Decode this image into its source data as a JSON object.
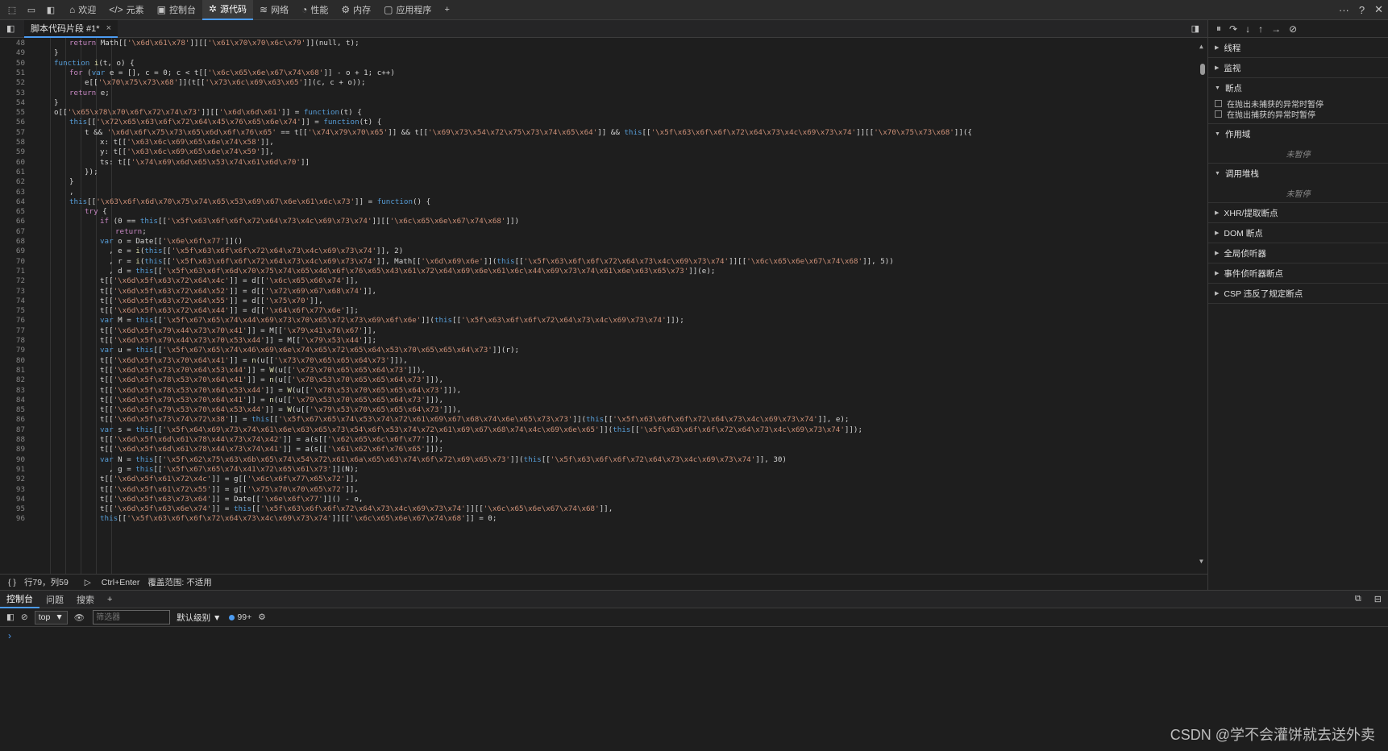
{
  "toolbar": {
    "tabs": [
      {
        "label": "欢迎",
        "icon": "home-icon"
      },
      {
        "label": "元素",
        "icon": "code-icon"
      },
      {
        "label": "控制台",
        "icon": "terminal-icon"
      },
      {
        "label": "源代码",
        "icon": "bug-icon"
      },
      {
        "label": "网络",
        "icon": "wifi-icon"
      },
      {
        "label": "性能",
        "icon": "gauge-icon"
      },
      {
        "label": "内存",
        "icon": "gear-icon"
      },
      {
        "label": "应用程序",
        "icon": "window-icon"
      }
    ],
    "add": "+",
    "more": "···",
    "help": "?",
    "close": "✕"
  },
  "file_tab": {
    "label": "脚本代码片段 #1*",
    "close": "×"
  },
  "editor": {
    "lines": [
      {
        "n": "48",
        "indent": 3,
        "html": "<span class=\"kw2\">return</span> Math[[<span class=\"str\">'\\x6d\\x61\\x78'</span>]][[<span class=\"str\">'\\x61\\x70\\x70\\x6c\\x79'</span>]](null, t);"
      },
      {
        "n": "49",
        "indent": 2,
        "html": "}"
      },
      {
        "n": "50",
        "indent": 2,
        "html": "<span class=\"kw\">function</span> <span class=\"fn\">i</span>(t, o) {"
      },
      {
        "n": "51",
        "indent": 3,
        "html": "<span class=\"kw2\">for</span> (<span class=\"kw\">var</span> e = [], c = 0; c &lt; t[[<span class=\"str\">'\\x6c\\x65\\x6e\\x67\\x74\\x68'</span>]] - o + 1; c++)"
      },
      {
        "n": "52",
        "indent": 4,
        "html": "e[[<span class=\"str\">'\\x70\\x75\\x73\\x68'</span>]](t[[<span class=\"str\">'\\x73\\x6c\\x69\\x63\\x65'</span>]](c, c + o));"
      },
      {
        "n": "53",
        "indent": 3,
        "html": "<span class=\"kw2\">return</span> e;"
      },
      {
        "n": "54",
        "indent": 2,
        "html": "}"
      },
      {
        "n": "55",
        "indent": 2,
        "html": "o[[<span class=\"str\">'\\x65\\x78\\x70\\x6f\\x72\\x74\\x73'</span>]][[<span class=\"str\">'\\x6d\\x6d\\x61'</span>]] = <span class=\"kw\">function</span>(t) {"
      },
      {
        "n": "56",
        "indent": 3,
        "html": "<span class=\"kw\">this</span>[[<span class=\"str\">'\\x72\\x65\\x63\\x6f\\x72\\x64\\x45\\x76\\x65\\x6e\\x74'</span>]] = <span class=\"kw\">function</span>(t) {"
      },
      {
        "n": "57",
        "indent": 4,
        "html": "t &amp;&amp; <span class=\"str\">'\\x6d\\x6f\\x75\\x73\\x65\\x6d\\x6f\\x76\\x65'</span> == t[[<span class=\"str\">'\\x74\\x79\\x70\\x65'</span>]] &amp;&amp; t[[<span class=\"str\">'\\x69\\x73\\x54\\x72\\x75\\x73\\x74\\x65\\x64'</span>]] &amp;&amp; <span class=\"kw\">this</span>[[<span class=\"str\">'\\x5f\\x63\\x6f\\x6f\\x72\\x64\\x73\\x4c\\x69\\x73\\x74'</span>]][[<span class=\"str\">'\\x70\\x75\\x73\\x68'</span>]]({"
      },
      {
        "n": "58",
        "indent": 5,
        "html": "x: t[[<span class=\"str\">'\\x63\\x6c\\x69\\x65\\x6e\\x74\\x58'</span>]],"
      },
      {
        "n": "59",
        "indent": 5,
        "html": "y: t[[<span class=\"str\">'\\x63\\x6c\\x69\\x65\\x6e\\x74\\x59'</span>]],"
      },
      {
        "n": "60",
        "indent": 5,
        "html": "ts: t[[<span class=\"str\">'\\x74\\x69\\x6d\\x65\\x53\\x74\\x61\\x6d\\x70'</span>]]"
      },
      {
        "n": "61",
        "indent": 4,
        "html": "});"
      },
      {
        "n": "62",
        "indent": 3,
        "html": "}"
      },
      {
        "n": "63",
        "indent": 3,
        "html": ","
      },
      {
        "n": "64",
        "indent": 3,
        "html": "<span class=\"kw\">this</span>[[<span class=\"str\">'\\x63\\x6f\\x6d\\x70\\x75\\x74\\x65\\x53\\x69\\x67\\x6e\\x61\\x6c\\x73'</span>]] = <span class=\"kw\">function</span>() {"
      },
      {
        "n": "65",
        "indent": 4,
        "html": "<span class=\"kw2\">try</span> {"
      },
      {
        "n": "66",
        "indent": 5,
        "html": "<span class=\"kw2\">if</span> (0 == <span class=\"kw\">this</span>[[<span class=\"str\">'\\x5f\\x63\\x6f\\x6f\\x72\\x64\\x73\\x4c\\x69\\x73\\x74'</span>]][[<span class=\"str\">'\\x6c\\x65\\x6e\\x67\\x74\\x68'</span>]])"
      },
      {
        "n": "67",
        "indent": 6,
        "html": "<span class=\"kw2\">return</span>;"
      },
      {
        "n": "68",
        "indent": 5,
        "html": "<span class=\"kw\">var</span> o = Date[[<span class=\"str\">'\\x6e\\x6f\\x77'</span>]]()"
      },
      {
        "n": "69",
        "indent": 5,
        "html": "  , e = <span class=\"fn\">i</span>(<span class=\"kw\">this</span>[[<span class=\"str\">'\\x5f\\x63\\x6f\\x6f\\x72\\x64\\x73\\x4c\\x69\\x73\\x74'</span>]], 2)"
      },
      {
        "n": "70",
        "indent": 5,
        "html": "  , r = <span class=\"fn\">i</span>(<span class=\"kw\">this</span>[[<span class=\"str\">'\\x5f\\x63\\x6f\\x6f\\x72\\x64\\x73\\x4c\\x69\\x73\\x74'</span>]], Math[[<span class=\"str\">'\\x6d\\x69\\x6e'</span>]](<span class=\"kw\">this</span>[[<span class=\"str\">'\\x5f\\x63\\x6f\\x6f\\x72\\x64\\x73\\x4c\\x69\\x73\\x74'</span>]][[<span class=\"str\">'\\x6c\\x65\\x6e\\x67\\x74\\x68'</span>]], 5))"
      },
      {
        "n": "71",
        "indent": 5,
        "html": "  , d = <span class=\"kw\">this</span>[[<span class=\"str\">'\\x5f\\x63\\x6f\\x6d\\x70\\x75\\x74\\x65\\x4d\\x6f\\x76\\x65\\x43\\x61\\x72\\x64\\x69\\x6e\\x61\\x6c\\x44\\x69\\x73\\x74\\x61\\x6e\\x63\\x65\\x73'</span>]](e);"
      },
      {
        "n": "72",
        "indent": 5,
        "html": "t[[<span class=\"str\">'\\x6d\\x5f\\x63\\x72\\x64\\x4c'</span>]] = d[[<span class=\"str\">'\\x6c\\x65\\x66\\x74'</span>]],"
      },
      {
        "n": "73",
        "indent": 5,
        "html": "t[[<span class=\"str\">'\\x6d\\x5f\\x63\\x72\\x64\\x52'</span>]] = d[[<span class=\"str\">'\\x72\\x69\\x67\\x68\\x74'</span>]],"
      },
      {
        "n": "74",
        "indent": 5,
        "html": "t[[<span class=\"str\">'\\x6d\\x5f\\x63\\x72\\x64\\x55'</span>]] = d[[<span class=\"str\">'\\x75\\x70'</span>]],"
      },
      {
        "n": "75",
        "indent": 5,
        "html": "t[[<span class=\"str\">'\\x6d\\x5f\\x63\\x72\\x64\\x44'</span>]] = d[[<span class=\"str\">'\\x64\\x6f\\x77\\x6e'</span>]];"
      },
      {
        "n": "76",
        "indent": 5,
        "html": "<span class=\"kw\">var</span> M = <span class=\"kw\">this</span>[[<span class=\"str\">'\\x5f\\x67\\x65\\x74\\x44\\x69\\x73\\x70\\x65\\x72\\x73\\x69\\x6f\\x6e'</span>]](<span class=\"kw\">this</span>[[<span class=\"str\">'\\x5f\\x63\\x6f\\x6f\\x72\\x64\\x73\\x4c\\x69\\x73\\x74'</span>]]);"
      },
      {
        "n": "77",
        "indent": 5,
        "html": "t[[<span class=\"str\">'\\x6d\\x5f\\x79\\x44\\x73\\x70\\x41'</span>]] = M[[<span class=\"str\">'\\x79\\x41\\x76\\x67'</span>]],"
      },
      {
        "n": "78",
        "indent": 5,
        "html": "t[[<span class=\"str\">'\\x6d\\x5f\\x79\\x44\\x73\\x70\\x53\\x44'</span>]] = M[[<span class=\"str\">'\\x79\\x53\\x44'</span>]];"
      },
      {
        "n": "79",
        "indent": 5,
        "html": "<span class=\"kw\">var</span> u = <span class=\"kw\">this</span>[[<span class=\"str\">'\\x5f\\x67\\x65\\x74\\x46\\x69\\x6e\\x74\\x65\\x72\\x65\\x64\\x53\\x70\\x65\\x65\\x64\\x73'</span>]](r);"
      },
      {
        "n": "80",
        "indent": 5,
        "html": "t[[<span class=\"str\">'\\x6d\\x5f\\x73\\x70\\x64\\x41'</span>]] = <span class=\"fn\">n</span>(u[[<span class=\"str\">'\\x73\\x70\\x65\\x65\\x64\\x73'</span>]]),"
      },
      {
        "n": "81",
        "indent": 5,
        "html": "t[[<span class=\"str\">'\\x6d\\x5f\\x73\\x70\\x64\\x53\\x44'</span>]] = <span class=\"fn\">W</span>(u[[<span class=\"str\">'\\x73\\x70\\x65\\x65\\x64\\x73'</span>]]),"
      },
      {
        "n": "82",
        "indent": 5,
        "html": "t[[<span class=\"str\">'\\x6d\\x5f\\x78\\x53\\x70\\x64\\x41'</span>]] = <span class=\"fn\">n</span>(u[[<span class=\"str\">'\\x78\\x53\\x70\\x65\\x65\\x64\\x73'</span>]]),"
      },
      {
        "n": "83",
        "indent": 5,
        "html": "t[[<span class=\"str\">'\\x6d\\x5f\\x78\\x53\\x70\\x64\\x53\\x44'</span>]] = <span class=\"fn\">W</span>(u[[<span class=\"str\">'\\x78\\x53\\x70\\x65\\x65\\x64\\x73'</span>]]),"
      },
      {
        "n": "84",
        "indent": 5,
        "html": "t[[<span class=\"str\">'\\x6d\\x5f\\x79\\x53\\x70\\x64\\x41'</span>]] = <span class=\"fn\">n</span>(u[[<span class=\"str\">'\\x79\\x53\\x70\\x65\\x65\\x64\\x73'</span>]]),"
      },
      {
        "n": "85",
        "indent": 5,
        "html": "t[[<span class=\"str\">'\\x6d\\x5f\\x79\\x53\\x70\\x64\\x53\\x44'</span>]] = <span class=\"fn\">W</span>(u[[<span class=\"str\">'\\x79\\x53\\x70\\x65\\x65\\x64\\x73'</span>]]),"
      },
      {
        "n": "86",
        "indent": 5,
        "html": "t[[<span class=\"str\">'\\x6d\\x5f\\x73\\x74\\x72\\x38'</span>]] = <span class=\"kw\">this</span>[[<span class=\"str\">'\\x5f\\x67\\x65\\x74\\x53\\x74\\x72\\x61\\x69\\x67\\x68\\x74\\x6e\\x65\\x73\\x73'</span>]](<span class=\"kw\">this</span>[[<span class=\"str\">'\\x5f\\x63\\x6f\\x6f\\x72\\x64\\x73\\x4c\\x69\\x73\\x74'</span>]], e);"
      },
      {
        "n": "87",
        "indent": 5,
        "html": "<span class=\"kw\">var</span> s = <span class=\"kw\">this</span>[[<span class=\"str\">'\\x5f\\x64\\x69\\x73\\x74\\x61\\x6e\\x63\\x65\\x73\\x54\\x6f\\x53\\x74\\x72\\x61\\x69\\x67\\x68\\x74\\x4c\\x69\\x6e\\x65'</span>]](<span class=\"kw\">this</span>[[<span class=\"str\">'\\x5f\\x63\\x6f\\x6f\\x72\\x64\\x73\\x4c\\x69\\x73\\x74'</span>]]);"
      },
      {
        "n": "88",
        "indent": 5,
        "html": "t[[<span class=\"str\">'\\x6d\\x5f\\x6d\\x61\\x78\\x44\\x73\\x74\\x42'</span>]] = a(s[[<span class=\"str\">'\\x62\\x65\\x6c\\x6f\\x77'</span>]]),"
      },
      {
        "n": "89",
        "indent": 5,
        "html": "t[[<span class=\"str\">'\\x6d\\x5f\\x6d\\x61\\x78\\x44\\x73\\x74\\x41'</span>]] = a(s[[<span class=\"str\">'\\x61\\x62\\x6f\\x76\\x65'</span>]]);"
      },
      {
        "n": "90",
        "indent": 5,
        "html": "<span class=\"kw\">var</span> N = <span class=\"kw\">this</span>[[<span class=\"str\">'\\x5f\\x62\\x75\\x63\\x6b\\x65\\x74\\x54\\x72\\x61\\x6a\\x65\\x63\\x74\\x6f\\x72\\x69\\x65\\x73'</span>]](<span class=\"kw\">this</span>[[<span class=\"str\">'\\x5f\\x63\\x6f\\x6f\\x72\\x64\\x73\\x4c\\x69\\x73\\x74'</span>]], 30)"
      },
      {
        "n": "91",
        "indent": 5,
        "html": "  , g = <span class=\"kw\">this</span>[[<span class=\"str\">'\\x5f\\x67\\x65\\x74\\x41\\x72\\x65\\x61\\x73'</span>]](N);"
      },
      {
        "n": "92",
        "indent": 5,
        "html": "t[[<span class=\"str\">'\\x6d\\x5f\\x61\\x72\\x4c'</span>]] = g[[<span class=\"str\">'\\x6c\\x6f\\x77\\x65\\x72'</span>]],"
      },
      {
        "n": "93",
        "indent": 5,
        "html": "t[[<span class=\"str\">'\\x6d\\x5f\\x61\\x72\\x55'</span>]] = g[[<span class=\"str\">'\\x75\\x70\\x70\\x65\\x72'</span>]],"
      },
      {
        "n": "94",
        "indent": 5,
        "html": "t[[<span class=\"str\">'\\x6d\\x5f\\x63\\x73\\x64'</span>]] = Date[[<span class=\"str\">'\\x6e\\x6f\\x77'</span>]]() - o,"
      },
      {
        "n": "95",
        "indent": 5,
        "html": "t[[<span class=\"str\">'\\x6d\\x5f\\x63\\x6e\\x74'</span>]] = <span class=\"kw\">this</span>[[<span class=\"str\">'\\x5f\\x63\\x6f\\x6f\\x72\\x64\\x73\\x4c\\x69\\x73\\x74'</span>]][[<span class=\"str\">'\\x6c\\x65\\x6e\\x67\\x74\\x68'</span>]],"
      },
      {
        "n": "96",
        "indent": 5,
        "html": "<span class=\"kw\">this</span>[[<span class=\"str\">'\\x5f\\x63\\x6f\\x6f\\x72\\x64\\x73\\x4c\\x69\\x73\\x74'</span>]][[<span class=\"str\">'\\x6c\\x65\\x6e\\x67\\x74\\x68'</span>]] = 0;"
      }
    ]
  },
  "status": {
    "braces": "{ }",
    "position": "行79，列59",
    "run": "Ctrl+Enter",
    "coverage": "覆盖范围: 不适用"
  },
  "debugger": {
    "sections": [
      {
        "label": "线程",
        "open": false
      },
      {
        "label": "监视",
        "open": false
      },
      {
        "label": "断点",
        "open": true
      }
    ],
    "checkboxes": [
      "在抛出未捕获的异常时暂停",
      "在抛出捕获的异常时暂停"
    ],
    "scope": {
      "label": "作用域",
      "empty": "未暂停"
    },
    "callstack": {
      "label": "调用堆栈",
      "empty": "未暂停"
    },
    "more_sections": [
      "XHR/提取断点",
      "DOM 断点",
      "全局侦听器",
      "事件侦听器断点",
      "CSP 违反了规定断点"
    ]
  },
  "drawer": {
    "tabs": [
      "控制台",
      "问题",
      "搜索"
    ],
    "add": "+"
  },
  "console_toolbar": {
    "context": "top",
    "filter_placeholder": "筛选器",
    "level": "默认级别",
    "count": "99+"
  },
  "console": {
    "prompt": "›"
  },
  "watermark": "CSDN @学不会灌饼就去送外卖"
}
